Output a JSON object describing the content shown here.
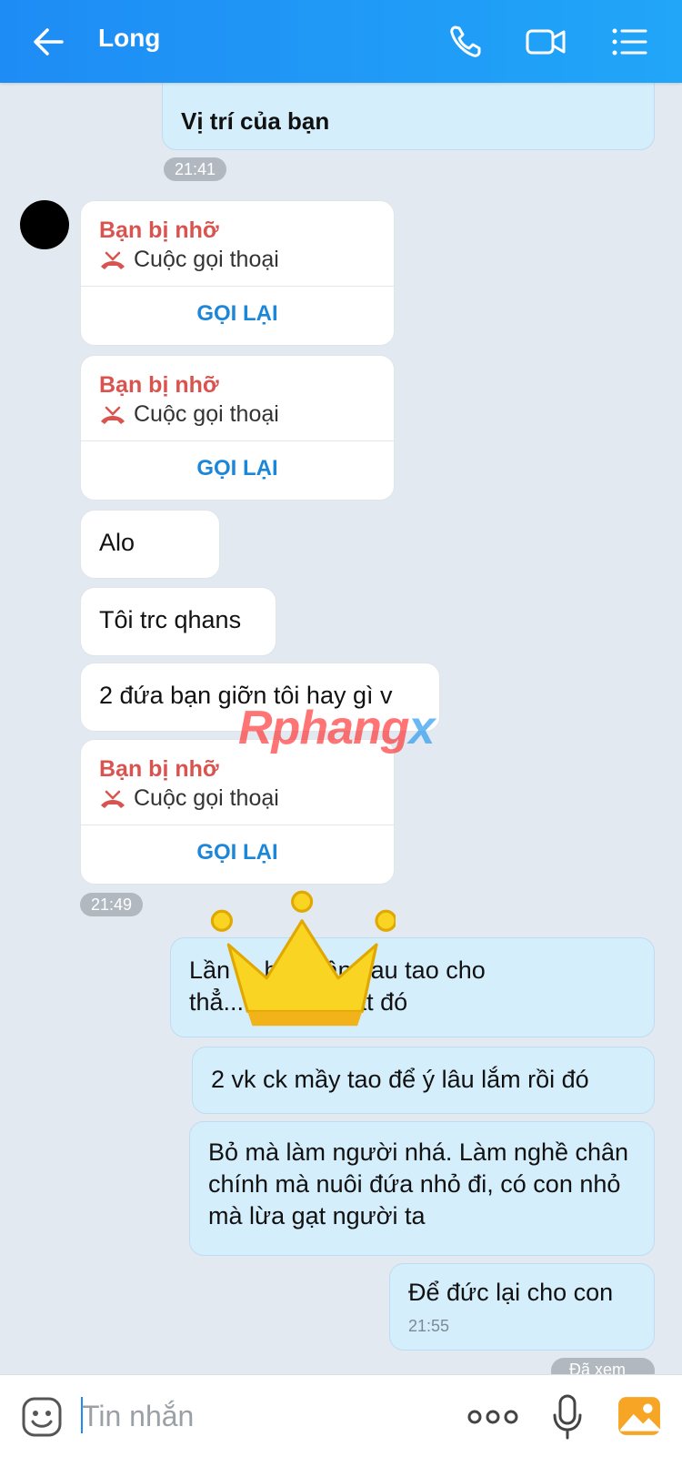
{
  "header": {
    "contact_name": "Long",
    "icons": [
      "back-arrow-icon",
      "phone-icon",
      "video-camera-icon",
      "list-menu-icon"
    ]
  },
  "messages": {
    "location_text": "Vị trí của bạn",
    "time_1": "21:41",
    "missed_title": "Bạn bị nhỡ",
    "missed_sub": "Cuộc gọi thoại",
    "callback_label": "GỌI LẠI",
    "msg_alo": "Alo",
    "msg_toi": "Tôi trc qhans",
    "msg_2dua": "2 đứa bạn giỡn tôi hay gì v",
    "time_2": "21:49",
    "out_1_line1": "Lần ... hội. Lần sau tao cho",
    "out_1_line2": "thẳ... g an p5 bắt đó",
    "out_2": "2 vk ck mầy tao để ý lâu lắm rồi đó",
    "out_3": "Bỏ mà làm người nhá. Làm nghề chân chính mà nuôi đứa nhỏ đi, có con nhỏ mà lừa gạt người ta",
    "out_4": "Để đức lại cho con",
    "time_3": "21:55",
    "seen_status": "Đã xem"
  },
  "watermark": {
    "text_main": "Rphang",
    "text_x": "x"
  },
  "input": {
    "placeholder": "Tin nhắn",
    "icons": [
      "sticker-icon",
      "more-options-icon",
      "microphone-icon",
      "image-icon"
    ]
  },
  "colors": {
    "header": "#1e8cf5",
    "outgoing_bubble": "#d5eefc",
    "missed_red": "#d9534f",
    "callback_blue": "#1c86d9"
  }
}
